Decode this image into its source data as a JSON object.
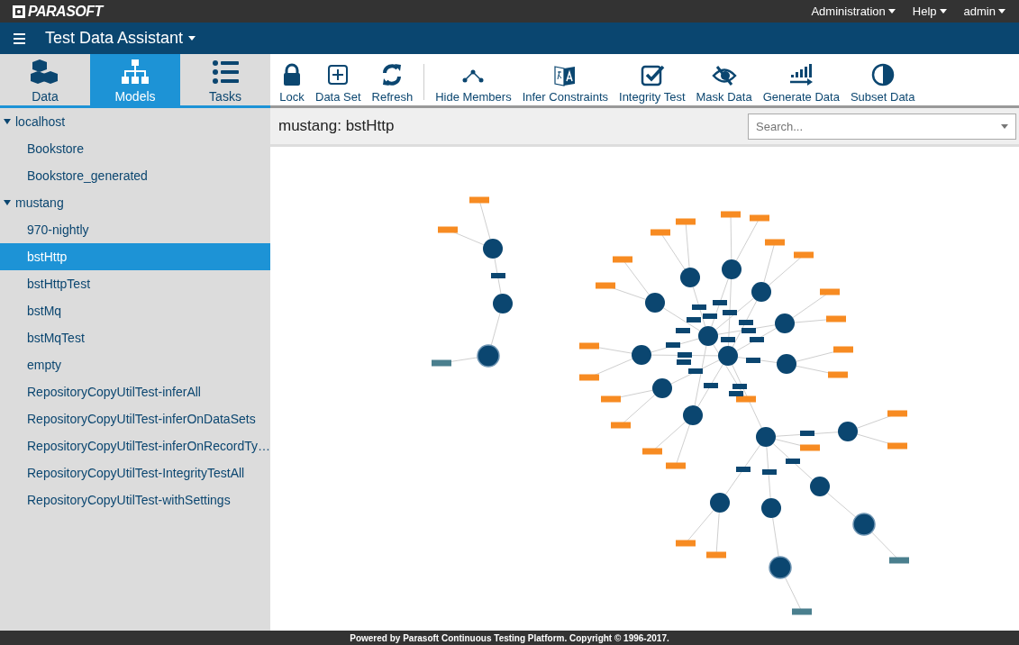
{
  "header": {
    "logo": "PARASOFT",
    "menus": [
      {
        "label": "Administration"
      },
      {
        "label": "Help"
      },
      {
        "label": "admin"
      }
    ]
  },
  "app_bar": {
    "title": "Test Data Assistant"
  },
  "sidebar": {
    "tabs": [
      {
        "label": "Data",
        "kind": "data",
        "selected": false
      },
      {
        "label": "Models",
        "kind": "models",
        "selected": true
      },
      {
        "label": "Tasks",
        "kind": "tasks",
        "selected": false
      }
    ],
    "tree": [
      {
        "label": "localhost",
        "expanded": true,
        "selected": false,
        "children": [
          {
            "label": "Bookstore",
            "selected": false
          },
          {
            "label": "Bookstore_generated",
            "selected": false
          }
        ]
      },
      {
        "label": "mustang",
        "expanded": true,
        "selected": false,
        "children": [
          {
            "label": "970-nightly",
            "selected": false
          },
          {
            "label": "bstHttp",
            "selected": true
          },
          {
            "label": "bstHttpTest",
            "selected": false
          },
          {
            "label": "bstMq",
            "selected": false
          },
          {
            "label": "bstMqTest",
            "selected": false
          },
          {
            "label": "empty",
            "selected": false
          },
          {
            "label": "RepositoryCopyUtilTest-inferAll",
            "selected": false
          },
          {
            "label": "RepositoryCopyUtilTest-inferOnDataSets",
            "selected": false
          },
          {
            "label": "RepositoryCopyUtilTest-inferOnRecordTy…",
            "selected": false
          },
          {
            "label": "RepositoryCopyUtilTest-IntegrityTestAll",
            "selected": false
          },
          {
            "label": "RepositoryCopyUtilTest-withSettings",
            "selected": false
          }
        ]
      }
    ]
  },
  "toolbar": {
    "buttons": [
      {
        "label": "Lock",
        "kind": "lock"
      },
      {
        "label": "Data Set",
        "kind": "dataset"
      },
      {
        "label": "Refresh",
        "kind": "refresh"
      },
      {
        "label": "Hide Members",
        "kind": "hide"
      },
      {
        "label": "Infer Constraints",
        "kind": "infer"
      },
      {
        "label": "Integrity Test",
        "kind": "integrity"
      },
      {
        "label": "Mask Data",
        "kind": "mask"
      },
      {
        "label": "Generate Data",
        "kind": "generate"
      },
      {
        "label": "Subset Data",
        "kind": "subset"
      }
    ]
  },
  "content": {
    "title": "mustang: bstHttp",
    "search": {
      "placeholder": "Search..."
    }
  },
  "footer": {
    "text": "Powered by Parasoft Continuous Testing Platform. Copyright © 1996-2017."
  }
}
